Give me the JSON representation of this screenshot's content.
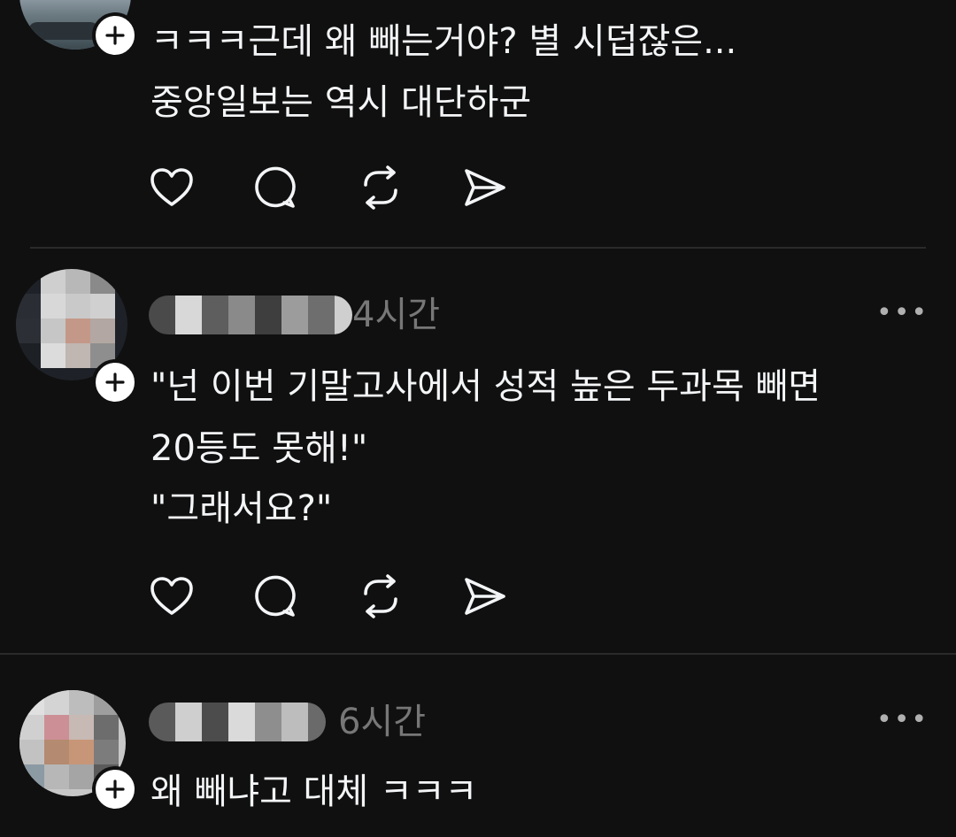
{
  "posts": [
    {
      "timestamp": "",
      "lines": [
        "ㅋㅋㅋ근데 왜 빼는거야? 별 시덥잖은...",
        "중앙일보는 역시 대단하군"
      ]
    },
    {
      "timestamp": "4시간",
      "lines": [
        "\"넌 이번 기말고사에서 성적 높은 두과목 빼면",
        "20등도 못해!\"",
        "\"그래서요?\""
      ]
    },
    {
      "timestamp": "6시간",
      "lines": [
        "왜 빼냐고 대체 ㅋㅋㅋ"
      ]
    }
  ],
  "icons": {
    "like": "heart-icon",
    "reply": "comment-icon",
    "repost": "repost-icon",
    "share": "send-icon",
    "more": "more-icon",
    "follow": "plus-icon"
  },
  "colors": {
    "background": "#101010",
    "text": "#f3f5f7",
    "muted": "#777777",
    "divider": "#2a2a2a"
  }
}
